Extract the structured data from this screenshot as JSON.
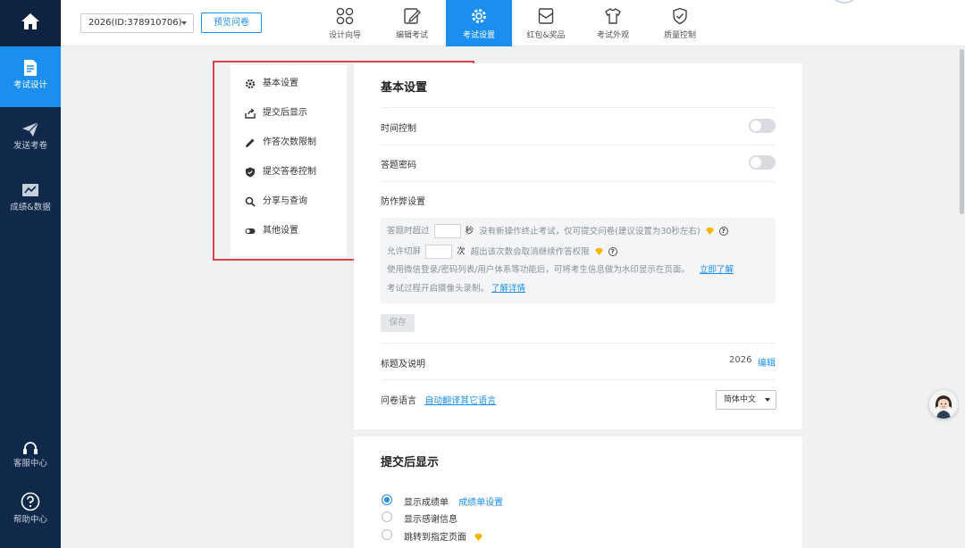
{
  "sidebar": {
    "items": [
      {
        "label": "考试设计",
        "icon": "exam-design-icon"
      },
      {
        "label": "发送考卷",
        "icon": "send-icon"
      },
      {
        "label": "成绩&数据",
        "icon": "chart-icon"
      }
    ],
    "bottom": [
      {
        "label": "客服中心",
        "icon": "headset-icon"
      },
      {
        "label": "帮助中心",
        "icon": "help-icon"
      }
    ]
  },
  "topbar": {
    "survey_select": "2026(ID:378910706)",
    "preview_label": "预览问卷",
    "tabs": [
      {
        "label": "设计向导",
        "icon": "grid-icon"
      },
      {
        "label": "编辑考试",
        "icon": "edit-icon"
      },
      {
        "label": "考试设置",
        "icon": "gear-icon",
        "active": true
      },
      {
        "label": "红包&奖品",
        "icon": "red-packet-icon"
      },
      {
        "label": "考试外观",
        "icon": "shirt-icon"
      },
      {
        "label": "质量控制",
        "icon": "shield-icon"
      }
    ]
  },
  "left_menu": {
    "items": [
      {
        "label": "基本设置",
        "icon": "gear-icon"
      },
      {
        "label": "提交后显示",
        "icon": "share-out-icon"
      },
      {
        "label": "作答次数限制",
        "icon": "pencil-icon"
      },
      {
        "label": "提交答卷控制",
        "icon": "shield-icon"
      },
      {
        "label": "分享与查询",
        "icon": "search-icon"
      },
      {
        "label": "其他设置",
        "icon": "toggle-icon"
      }
    ]
  },
  "basic": {
    "title": "基本设置",
    "time_control": "时间控制",
    "answer_password": "答题密码",
    "anti_cheat_title": "防作弊设置",
    "ac1_prefix": "答题时超过",
    "ac1_unit": "秒",
    "ac1_text": "没有新操作终止考试，仅可提交问卷(建议设置为30秒左右)",
    "ac2_prefix": "允许切屏",
    "ac2_unit": "次",
    "ac2_text": "超出该次数会取消继续作答权限",
    "ac3_text": "使用微信登录/密码列表/用户体系等功能后，可将考生信息做为水印显示在页面。",
    "ac3_link": "立即了解",
    "ac4_text": "考试过程开启摄像头录制。",
    "ac4_link": "了解详情",
    "save_label": "保存",
    "title_desc_label": "标题及说明",
    "title_desc_value": "2026",
    "edit_label": "编辑",
    "language_label": "问卷语言",
    "translate_link": "自动翻译其它语言",
    "language_value": "简体中文",
    "qmark": "?"
  },
  "after_submit": {
    "title": "提交后显示",
    "options": [
      {
        "label": "显示成绩单",
        "checked": true,
        "link": "成绩单设置"
      },
      {
        "label": "显示感谢信息",
        "checked": false
      },
      {
        "label": "跳转到指定页面",
        "checked": false,
        "badge": "diamond"
      }
    ]
  },
  "colors": {
    "accent": "#1a8ff0",
    "sidebar": "#10294a",
    "highlight": "#e0424a",
    "diamond": "#f5b800"
  }
}
